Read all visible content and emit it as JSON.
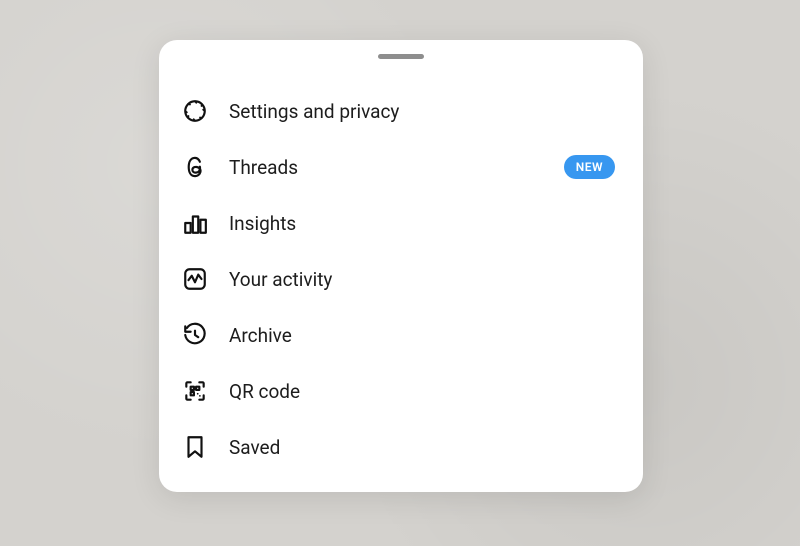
{
  "menu": {
    "items": [
      {
        "id": "settings-privacy",
        "label": "Settings and privacy",
        "icon": "settings-icon",
        "badge": null
      },
      {
        "id": "threads",
        "label": "Threads",
        "icon": "threads-icon",
        "badge": "NEW"
      },
      {
        "id": "insights",
        "label": "Insights",
        "icon": "insights-icon",
        "badge": null
      },
      {
        "id": "your-activity",
        "label": "Your activity",
        "icon": "activity-icon",
        "badge": null
      },
      {
        "id": "archive",
        "label": "Archive",
        "icon": "archive-icon",
        "badge": null
      },
      {
        "id": "qr-code",
        "label": "QR code",
        "icon": "qr-code-icon",
        "badge": null
      },
      {
        "id": "saved",
        "label": "Saved",
        "icon": "saved-icon",
        "badge": null
      }
    ]
  },
  "colors": {
    "badge_bg": "#3797f0",
    "sheet_bg": "#ffffff",
    "page_bg": "#d4d2ce"
  }
}
